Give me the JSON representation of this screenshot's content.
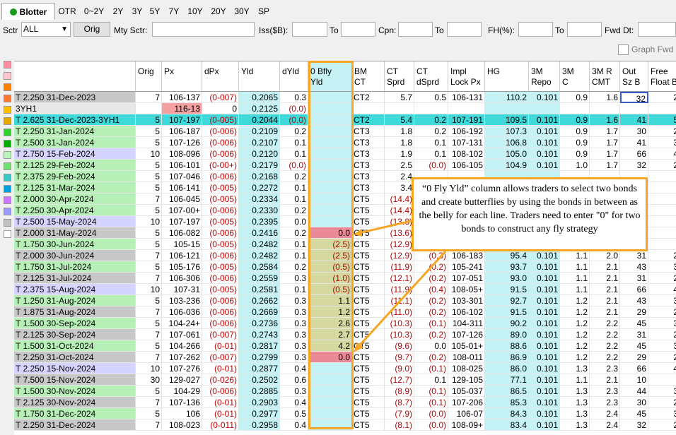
{
  "tabs": [
    "Blotter",
    "OTR",
    "0~2Y",
    "2Y",
    "3Y",
    "5Y",
    "7Y",
    "10Y",
    "20Y",
    "30Y",
    "SP"
  ],
  "filters": {
    "sctr_label": "Sctr",
    "sctr_value": "ALL",
    "orig_button": "Orig",
    "mty_sctr_label": "Mty Sctr:",
    "iss_label": "Iss($B):",
    "to1": "To",
    "cpn_label": "Cpn:",
    "to2": "To",
    "fh_label": "FH(%):",
    "to3": "To",
    "fwd_dt_label": "Fwd Dt:",
    "graph_fwd_label": "Graph Fwd"
  },
  "swatch_colors": [
    "#ff8fa0",
    "#ffc6d0",
    "#ff8000",
    "#ff7a30",
    "#ffc000",
    "#e6a800",
    "#2ed12e",
    "#00aa00",
    "#b8f5b8",
    "#70e070",
    "#3cc7c7",
    "#00a0e0",
    "#cc77ff",
    "#9999ff",
    "#c0c0c0",
    "#ffffff"
  ],
  "columns": [
    "",
    "Orig",
    "Px",
    "dPx",
    "Yld",
    "dYld",
    "0 Bfly\nYld",
    "BM\nCT",
    "CT\nSprd",
    "CT\ndSprd",
    "Impl\nLock Px",
    "HG",
    "3M\nRepo",
    "3M\nC",
    "3M R\nCMT",
    "Out\nSz B",
    "Free\nFloat B"
  ],
  "rows": [
    {
      "bg": "#c8c8c8",
      "name": "T 2.250 31-Dec-2023",
      "orig": "7",
      "px": "106-137",
      "dpx": "(0-007)",
      "yld": "0.2065",
      "dyld": "0.3",
      "bfly": "",
      "bm": "CT2",
      "sprd": "5.7",
      "dsprd": "0.5",
      "lock": "106-131",
      "hg": "110.2",
      "repo": "0.101",
      "c3m": "0.9",
      "rcmt": "1.6",
      "out": "32",
      "free": "2"
    },
    {
      "bg": "#e8e8e8",
      "name": "3YH1",
      "orig": "",
      "px": "116-13",
      "dpx": "0",
      "yld": "0.2125",
      "dyld": "(0.0)",
      "bfly": "",
      "bm": "",
      "sprd": "",
      "dsprd": "",
      "lock": "",
      "hg": "",
      "repo": "",
      "c3m": "",
      "rcmt": "",
      "out": "",
      "free": ""
    },
    {
      "bg": "#3fd9d9",
      "name": "T 2.625 31-Dec-2023-3YH1",
      "orig": "5",
      "px": "107-197",
      "dpx": "(0-005)",
      "yld": "0.2044",
      "dyld": "(0.0)",
      "bfly": "",
      "bm": "CT2",
      "sprd": "5.4",
      "dsprd": "0.2",
      "lock": "107-191",
      "hg": "109.5",
      "repo": "0.101",
      "c3m": "0.9",
      "rcmt": "1.6",
      "out": "41",
      "free": "5"
    },
    {
      "bg": "#b6f0b6",
      "name": "T 2.250 31-Jan-2024",
      "orig": "5",
      "px": "106-187",
      "dpx": "(0-006)",
      "yld": "0.2109",
      "dyld": "0.2",
      "bfly": "",
      "bm": "CT3",
      "sprd": "1.8",
      "dsprd": "0.2",
      "lock": "106-192",
      "hg": "107.3",
      "repo": "0.101",
      "c3m": "0.9",
      "rcmt": "1.7",
      "out": "30",
      "free": "2"
    },
    {
      "bg": "#b6f0b6",
      "name": "T 2.500 31-Jan-2024",
      "orig": "5",
      "px": "107-126",
      "dpx": "(0-006)",
      "yld": "0.2107",
      "dyld": "0.1",
      "bfly": "",
      "bm": "CT3",
      "sprd": "1.8",
      "dsprd": "0.1",
      "lock": "107-131",
      "hg": "106.8",
      "repo": "0.101",
      "c3m": "0.9",
      "rcmt": "1.7",
      "out": "41",
      "free": "3"
    },
    {
      "bg": "#d4d4ff",
      "name": "T 2.750 15-Feb-2024",
      "orig": "10",
      "px": "108-096",
      "dpx": "(0-006)",
      "yld": "0.2120",
      "dyld": "0.1",
      "bfly": "",
      "bm": "CT3",
      "sprd": "1.9",
      "dsprd": "0.1",
      "lock": "108-102",
      "hg": "105.0",
      "repo": "0.101",
      "c3m": "0.9",
      "rcmt": "1.7",
      "out": "66",
      "free": "4"
    },
    {
      "bg": "#b6f0b6",
      "name": "T 2.125 29-Feb-2024",
      "orig": "5",
      "px": "106-101",
      "dpx": "(0-00+)",
      "yld": "0.2179",
      "dyld": "(0.0)",
      "bfly": "",
      "bm": "CT3",
      "sprd": "2.5",
      "dsprd": "(0.0)",
      "lock": "106-105",
      "hg": "104.9",
      "repo": "0.101",
      "c3m": "1.0",
      "rcmt": "1.7",
      "out": "32",
      "free": "2"
    },
    {
      "bg": "#b6f0b6",
      "name": "T 2.375 29-Feb-2024",
      "orig": "5",
      "px": "107-046",
      "dpx": "(0-006)",
      "yld": "0.2168",
      "dyld": "0.2",
      "bfly": "",
      "bm": "CT3",
      "sprd": "2.4",
      "dsprd": "",
      "lock": "",
      "hg": "",
      "repo": "",
      "c3m": "",
      "rcmt": "",
      "out": "",
      "free": ""
    },
    {
      "bg": "#b6f0b6",
      "name": "T 2.125 31-Mar-2024",
      "orig": "5",
      "px": "106-141",
      "dpx": "(0-005)",
      "yld": "0.2272",
      "dyld": "0.1",
      "bfly": "",
      "bm": "CT3",
      "sprd": "3.4",
      "dsprd": "",
      "lock": "",
      "hg": "",
      "repo": "",
      "c3m": "",
      "rcmt": "",
      "out": "",
      "free": ""
    },
    {
      "bg": "#b6f0b6",
      "name": "T 2.000 30-Apr-2024",
      "orig": "7",
      "px": "106-045",
      "dpx": "(0-005)",
      "yld": "0.2334",
      "dyld": "0.1",
      "bfly": "",
      "bm": "CT5",
      "sprd": "(14.4)",
      "dsprd": "",
      "lock": "",
      "hg": "",
      "repo": "",
      "c3m": "",
      "rcmt": "",
      "out": "",
      "free": ""
    },
    {
      "bg": "#b6f0b6",
      "name": "T 2.250 30-Apr-2024",
      "orig": "5",
      "px": "107-00+",
      "dpx": "(0-006)",
      "yld": "0.2330",
      "dyld": "0.2",
      "bfly": "",
      "bm": "CT5",
      "sprd": "(14.4)",
      "dsprd": "",
      "lock": "",
      "hg": "",
      "repo": "",
      "c3m": "",
      "rcmt": "",
      "out": "",
      "free": ""
    },
    {
      "bg": "#d4d4ff",
      "name": "T 2.500 15-May-2024",
      "orig": "10",
      "px": "107-197",
      "dpx": "(0-005)",
      "yld": "0.2395",
      "dyld": "0.0",
      "bfly": "",
      "bm": "CT5",
      "sprd": "(13.8)",
      "dsprd": "",
      "lock": "",
      "hg": "",
      "repo": "",
      "c3m": "",
      "rcmt": "",
      "out": "",
      "free": ""
    },
    {
      "bg": "#c8c8c8",
      "name": "T 2.000 31-May-2024",
      "orig": "5",
      "px": "106-082",
      "dpx": "(0-006)",
      "yld": "0.2416",
      "dyld": "0.2",
      "bfly": "0.0",
      "bm": "CT5",
      "sprd": "(13.6)",
      "dsprd": "",
      "lock": "",
      "hg": "",
      "repo": "",
      "c3m": "",
      "rcmt": "",
      "out": "",
      "free": ""
    },
    {
      "bg": "#b6f0b6",
      "name": "T 1.750 30-Jun-2024",
      "orig": "5",
      "px": "105-15",
      "dpx": "(0-005)",
      "yld": "0.2482",
      "dyld": "0.1",
      "bfly": "(2.5)",
      "bm": "CT5",
      "sprd": "(12.9)",
      "dsprd": "",
      "lock": "",
      "hg": "",
      "repo": "",
      "c3m": "",
      "rcmt": "",
      "out": "",
      "free": ""
    },
    {
      "bg": "#c8c8c8",
      "name": "T 2.000 30-Jun-2024",
      "orig": "7",
      "px": "106-121",
      "dpx": "(0-006)",
      "yld": "0.2482",
      "dyld": "0.1",
      "bfly": "(2.5)",
      "bm": "CT5",
      "sprd": "(12.9)",
      "dsprd": "(0.3)",
      "lock": "106-183",
      "hg": "95.4",
      "repo": "0.101",
      "c3m": "1.1",
      "rcmt": "2.0",
      "out": "31",
      "free": "2"
    },
    {
      "bg": "#b6f0b6",
      "name": "T 1.750 31-Jul-2024",
      "orig": "5",
      "px": "105-176",
      "dpx": "(0-005)",
      "yld": "0.2584",
      "dyld": "0.2",
      "bfly": "(0.5)",
      "bm": "CT5",
      "sprd": "(11.9)",
      "dsprd": "(0.2)",
      "lock": "105-241",
      "hg": "93.7",
      "repo": "0.101",
      "c3m": "1.1",
      "rcmt": "2.1",
      "out": "43",
      "free": "3"
    },
    {
      "bg": "#c8c8c8",
      "name": "T 2.125 31-Jul-2024",
      "orig": "7",
      "px": "106-306",
      "dpx": "(0-006)",
      "yld": "0.2559",
      "dyld": "0.3",
      "bfly": "(1.0)",
      "bm": "CT5",
      "sprd": "(12.1)",
      "dsprd": "(0.2)",
      "lock": "107-051",
      "hg": "93.0",
      "repo": "0.101",
      "c3m": "1.1",
      "rcmt": "2.1",
      "out": "31",
      "free": "2"
    },
    {
      "bg": "#d4d4ff",
      "name": "T 2.375 15-Aug-2024",
      "orig": "10",
      "px": "107-31",
      "dpx": "(0-005)",
      "yld": "0.2581",
      "dyld": "0.1",
      "bfly": "(0.5)",
      "bm": "CT5",
      "sprd": "(11.9)",
      "dsprd": "(0.4)",
      "lock": "108-05+",
      "hg": "91.5",
      "repo": "0.101",
      "c3m": "1.1",
      "rcmt": "2.1",
      "out": "66",
      "free": "4"
    },
    {
      "bg": "#b6f0b6",
      "name": "T 1.250 31-Aug-2024",
      "orig": "5",
      "px": "103-236",
      "dpx": "(0-006)",
      "yld": "0.2662",
      "dyld": "0.3",
      "bfly": "1.1",
      "bm": "CT5",
      "sprd": "(11.1)",
      "dsprd": "(0.2)",
      "lock": "103-301",
      "hg": "92.7",
      "repo": "0.101",
      "c3m": "1.2",
      "rcmt": "2.1",
      "out": "43",
      "free": "3"
    },
    {
      "bg": "#c8c8c8",
      "name": "T 1.875 31-Aug-2024",
      "orig": "7",
      "px": "106-036",
      "dpx": "(0-006)",
      "yld": "0.2669",
      "dyld": "0.3",
      "bfly": "1.2",
      "bm": "CT5",
      "sprd": "(11.0)",
      "dsprd": "(0.2)",
      "lock": "106-102",
      "hg": "91.5",
      "repo": "0.101",
      "c3m": "1.2",
      "rcmt": "2.1",
      "out": "29",
      "free": "2"
    },
    {
      "bg": "#b6f0b6",
      "name": "T 1.500 30-Sep-2024",
      "orig": "5",
      "px": "104-24+",
      "dpx": "(0-006)",
      "yld": "0.2736",
      "dyld": "0.3",
      "bfly": "2.6",
      "bm": "CT5",
      "sprd": "(10.3)",
      "dsprd": "(0.1)",
      "lock": "104-311",
      "hg": "90.2",
      "repo": "0.101",
      "c3m": "1.2",
      "rcmt": "2.2",
      "out": "45",
      "free": "3"
    },
    {
      "bg": "#c8c8c8",
      "name": "T 2.125 30-Sep-2024",
      "orig": "7",
      "px": "107-061",
      "dpx": "(0-007)",
      "yld": "0.2743",
      "dyld": "0.3",
      "bfly": "2.7",
      "bm": "CT5",
      "sprd": "(10.3)",
      "dsprd": "(0.2)",
      "lock": "107-126",
      "hg": "89.0",
      "repo": "0.101",
      "c3m": "1.2",
      "rcmt": "2.2",
      "out": "31",
      "free": "2"
    },
    {
      "bg": "#b6f0b6",
      "name": "T 1.500 31-Oct-2024",
      "orig": "5",
      "px": "104-266",
      "dpx": "(0-01)",
      "yld": "0.2817",
      "dyld": "0.3",
      "bfly": "4.2",
      "bm": "CT5",
      "sprd": "(9.6)",
      "dsprd": "0.0",
      "lock": "105-01+",
      "hg": "88.6",
      "repo": "0.101",
      "c3m": "1.2",
      "rcmt": "2.2",
      "out": "45",
      "free": "3"
    },
    {
      "bg": "#c8c8c8",
      "name": "T 2.250 31-Oct-2024",
      "orig": "7",
      "px": "107-262",
      "dpx": "(0-007)",
      "yld": "0.2799",
      "dyld": "0.3",
      "bfly": "0.0",
      "bm": "CT5",
      "sprd": "(9.7)",
      "dsprd": "(0.2)",
      "lock": "108-011",
      "hg": "86.9",
      "repo": "0.101",
      "c3m": "1.2",
      "rcmt": "2.2",
      "out": "29",
      "free": "2"
    },
    {
      "bg": "#d4d4ff",
      "name": "T 2.250 15-Nov-2024",
      "orig": "10",
      "px": "107-276",
      "dpx": "(0-01)",
      "yld": "0.2877",
      "dyld": "0.4",
      "bfly": "",
      "bm": "CT5",
      "sprd": "(9.0)",
      "dsprd": "(0.1)",
      "lock": "108-025",
      "hg": "86.0",
      "repo": "0.101",
      "c3m": "1.3",
      "rcmt": "2.3",
      "out": "66",
      "free": "4"
    },
    {
      "bg": "#c8c8c8",
      "name": "T 7.500 15-Nov-2024",
      "orig": "30",
      "px": "129-027",
      "dpx": "(0-026)",
      "yld": "0.2502",
      "dyld": "0.6",
      "bfly": "",
      "bm": "CT5",
      "sprd": "(12.7)",
      "dsprd": "0.1",
      "lock": "129-105",
      "hg": "77.1",
      "repo": "0.101",
      "c3m": "1.1",
      "rcmt": "2.1",
      "out": "10",
      "free": ""
    },
    {
      "bg": "#b6f0b6",
      "name": "T 1.500 30-Nov-2024",
      "orig": "5",
      "px": "104-29",
      "dpx": "(0-006)",
      "yld": "0.2885",
      "dyld": "0.3",
      "bfly": "",
      "bm": "CT5",
      "sprd": "(8.9)",
      "dsprd": "(0.1)",
      "lock": "105-037",
      "hg": "86.5",
      "repo": "0.101",
      "c3m": "1.3",
      "rcmt": "2.3",
      "out": "44",
      "free": "3"
    },
    {
      "bg": "#c8c8c8",
      "name": "T 2.125 30-Nov-2024",
      "orig": "7",
      "px": "107-136",
      "dpx": "(0-01)",
      "yld": "0.2903",
      "dyld": "0.4",
      "bfly": "",
      "bm": "CT5",
      "sprd": "(8.7)",
      "dsprd": "(0.1)",
      "lock": "107-206",
      "hg": "85.3",
      "repo": "0.101",
      "c3m": "1.3",
      "rcmt": "2.3",
      "out": "30",
      "free": "2"
    },
    {
      "bg": "#b6f0b6",
      "name": "T 1.750 31-Dec-2024",
      "orig": "5",
      "px": "106",
      "dpx": "(0-01)",
      "yld": "0.2977",
      "dyld": "0.5",
      "bfly": "",
      "bm": "CT5",
      "sprd": "(7.9)",
      "dsprd": "(0.0)",
      "lock": "106-07",
      "hg": "84.3",
      "repo": "0.101",
      "c3m": "1.3",
      "rcmt": "2.4",
      "out": "45",
      "free": "3"
    },
    {
      "bg": "#c8c8c8",
      "name": "T 2.250 31-Dec-2024",
      "orig": "7",
      "px": "108-023",
      "dpx": "(0-011)",
      "yld": "0.2958",
      "dyld": "0.4",
      "bfly": "",
      "bm": "CT5",
      "sprd": "(8.1)",
      "dsprd": "(0.0)",
      "lock": "108-09+",
      "hg": "83.4",
      "repo": "0.101",
      "c3m": "1.3",
      "rcmt": "2.4",
      "out": "32",
      "free": "2"
    }
  ],
  "callout": "“0 Fly Yld” column allows traders to select two bonds and create butterflies by using the bonds in between as the belly for each line. Traders need to enter \"0\" for two bonds to construct any fly strategy",
  "colors": {
    "highlight": "#f5a623",
    "negative": "#c00000",
    "bfly_col": "#c6f2f5",
    "bfly_val": "#d5d9a0",
    "bfly_zero": "#e98a96"
  }
}
